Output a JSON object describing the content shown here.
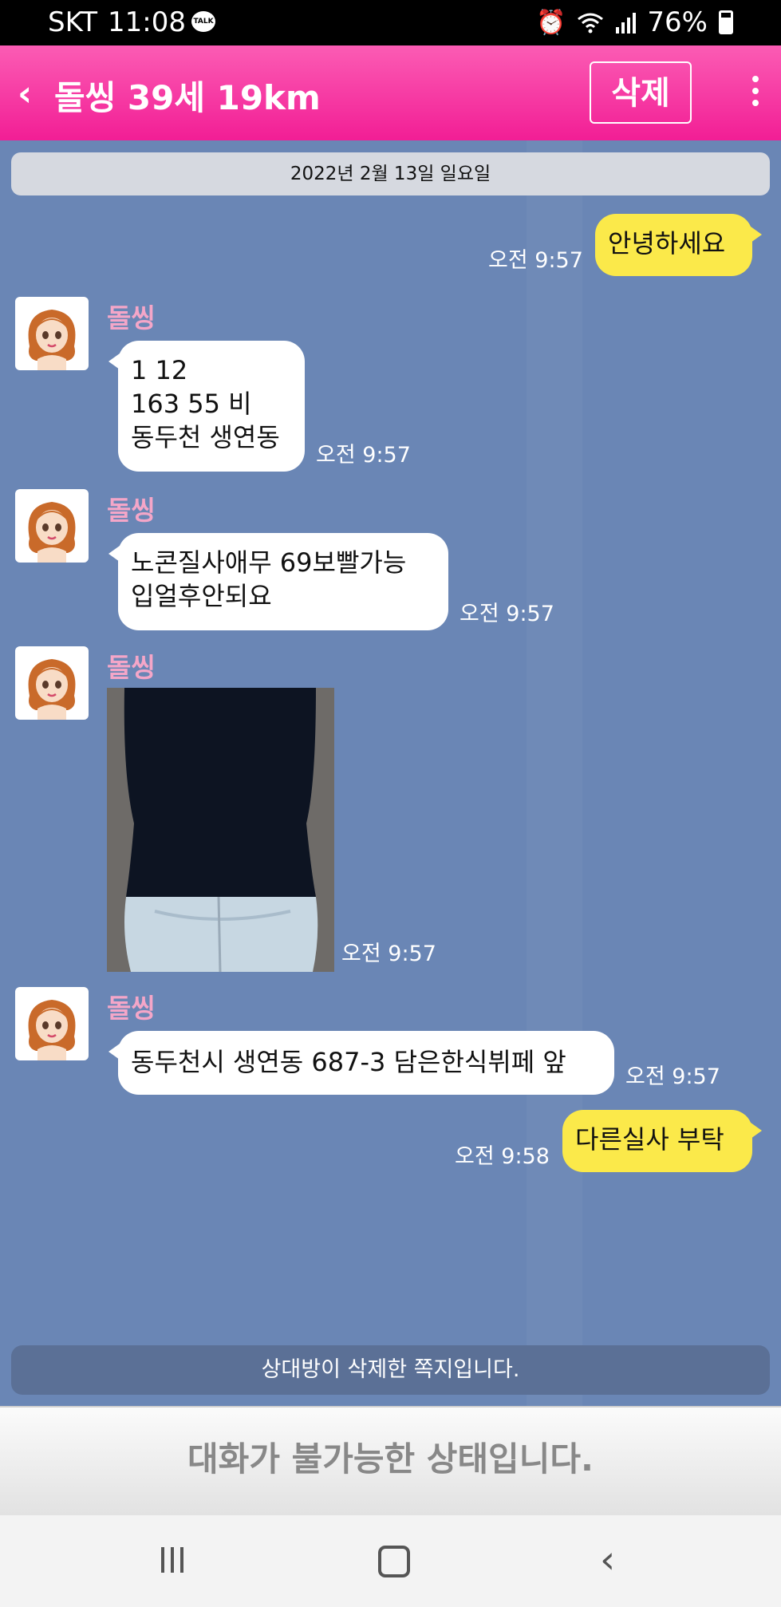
{
  "status_bar": {
    "carrier": "SKT",
    "time": "11:08",
    "talk_badge": "TALK",
    "battery": "76%",
    "icons": [
      "kakaotalk-icon",
      "alarm-icon",
      "wifi-icon",
      "signal-icon",
      "battery-icon"
    ]
  },
  "header": {
    "title": "돌씽 39세 19km",
    "delete_label": "삭제",
    "back_glyph": "‹",
    "background_colors": [
      "#fb5cb4",
      "#f21e95"
    ]
  },
  "chat": {
    "date": "2022년 2월 13일 일요일",
    "messages": [
      {
        "direction": "out",
        "lines": [
          "안녕하세요"
        ],
        "time": "오전 9:57"
      },
      {
        "direction": "in",
        "sender": "돌씽",
        "lines": [
          "1  12",
          "163 55 비",
          "동두천 생연동"
        ],
        "time": "오전 9:57"
      },
      {
        "direction": "in",
        "sender": "돌씽",
        "lines": [
          "노콘질사애무 69보빨가능",
          "입얼후안되요"
        ],
        "time": "오전 9:57"
      },
      {
        "direction": "in",
        "sender": "돌씽",
        "image": "photo",
        "time": "오전 9:57"
      },
      {
        "direction": "in",
        "sender": "돌씽",
        "lines": [
          "동두천시 생연동 687-3  담은한식뷔페 앞"
        ],
        "time": "오전 9:57"
      },
      {
        "direction": "out",
        "lines": [
          "다른실사 부탁"
        ],
        "time": "오전 9:58"
      }
    ],
    "deleted_notice": "상대방이 삭제한 쪽지입니다."
  },
  "footer": {
    "unavailable_text": "대화가 불가능한 상태입니다."
  },
  "colors": {
    "chat_bg": "#6a86b5",
    "out_bubble": "#fbe94a",
    "in_bubble": "#ffffff",
    "sender_name": "#f4a6c8"
  }
}
